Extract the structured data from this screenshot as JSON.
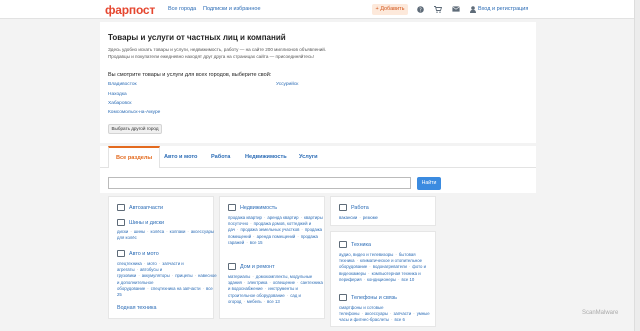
{
  "header": {
    "logo": "фарпост",
    "nav": [
      "Все города",
      "Подписки и избранное"
    ],
    "add_label": "+ Добавить",
    "login_label": "Вход и регистрация"
  },
  "intro": {
    "title": "Товары и услуги от частных лиц и компаний",
    "desc1": "Здесь удобно искать товары и услуги, недвижимость, работу — на сайте 200 миллионов объявлений.",
    "desc2": "Продавцы и покупатели ежедневно находят друг друга на страницах сайта — присоединяйтесь!",
    "city_heading": "Вы смотрите товары и услуги для всех городов, выберите свой:",
    "cities_left": [
      "Владивосток",
      "Находка",
      "Хабаровск",
      "Комсомольск-на-Амуре"
    ],
    "cities_right": [
      "Уссурийск"
    ],
    "other_city_btn": "Выбрать другой город"
  },
  "tabs": [
    "Все разделы",
    "Авто и мото",
    "Работа",
    "Недвижимость",
    "Услуги"
  ],
  "search": {
    "placeholder": "",
    "button": "Найти"
  },
  "categories": {
    "zapchasti": {
      "title": "Автозапчасти"
    },
    "shiny": {
      "title": "Шины и диски",
      "links": [
        "диски",
        "шины",
        "колёса",
        "колпаки",
        "аксессуары для колёс"
      ]
    },
    "avto": {
      "title": "Авто и мото",
      "links": [
        "спецтехника",
        "мото",
        "запчасти и агрегаты",
        "автобусы и грузовики",
        "аккумуляторы",
        "прицепы",
        "навесное и дополнительное оборудование",
        "спецтехника на запчасти",
        "все 25"
      ]
    },
    "vodnaya": {
      "title": "Водная техника"
    },
    "nedv": {
      "title": "Недвижимость",
      "links": [
        "продажа квартир",
        "аренда квартир",
        "квартиры посуточно",
        "продажа домов, коттеджей и дач",
        "продажа земельных участков",
        "продажа помещений",
        "аренда помещений",
        "продажа гаражей",
        "все 15"
      ]
    },
    "dom": {
      "title": "Дом и ремонт",
      "links": [
        "материалы",
        "домокомплекты, модульные здания",
        "электрика",
        "освещение",
        "сантехника и водоснабжение",
        "инструменты и строительное оборудование",
        "сад и огород",
        "мебель",
        "все 13"
      ]
    },
    "rabota": {
      "title": "Работа",
      "links": [
        "вакансии",
        "резюме"
      ]
    },
    "tehnika": {
      "title": "Техника",
      "links": [
        "аудио, видео и телевизоры",
        "бытовая техника",
        "климатическое и отопительное оборудование",
        "водонагреватели",
        "фото и видеокамеры",
        "компьютерная техника и периферия",
        "кондиционеры",
        "все 10"
      ]
    },
    "telefony": {
      "title": "Телефоны и связь",
      "links": [
        "смартфоны и сотовые телефоны",
        "аксессуары",
        "запчасти",
        "умные часы и фитнес-браслеты",
        "все 6"
      ]
    }
  },
  "watermark": "ScanMalware",
  "colors": {
    "brand": "#e5462f",
    "link": "#2a6bb5",
    "accent": "#e36a1e",
    "button": "#3b8be0"
  }
}
